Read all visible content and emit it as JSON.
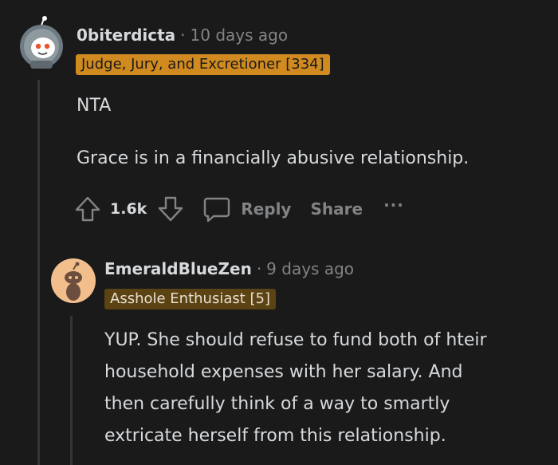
{
  "comment1": {
    "username": "0biterdicta",
    "separator": "·",
    "time": "10 days ago",
    "flair": "Judge, Jury, and Excretioner [334]",
    "body": [
      "NTA",
      "Grace is in a financially abusive relationship."
    ],
    "actions": {
      "upvote_icon": "upvote-arrow-icon",
      "score": "1.6k",
      "downvote_icon": "downvote-arrow-icon",
      "reply_icon": "speech-bubble-icon",
      "reply_label": "Reply",
      "share_label": "Share",
      "more_label": "···"
    }
  },
  "comment2": {
    "username": "EmeraldBlueZen",
    "separator": "·",
    "time": "9 days ago",
    "flair": "Asshole Enthusiast [5]",
    "body": [
      "YUP. She should refuse to fund both of hteir",
      "household expenses with her salary. And",
      "then carefully think of a way to smartly",
      "extricate herself from this relationship."
    ]
  },
  "colors": {
    "background": "#1a1a1b",
    "flair1_bg": "#d08a1f",
    "flair2_bg": "#5b4314",
    "text": "#d7dadc",
    "muted": "#818384",
    "thread_line": "#343536"
  }
}
